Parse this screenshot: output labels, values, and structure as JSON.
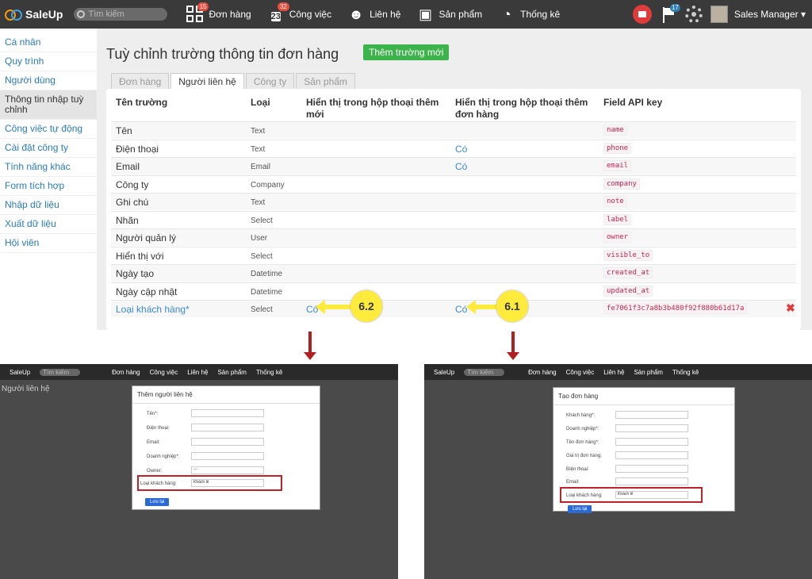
{
  "topbar": {
    "brand": "SaleUp",
    "search_placeholder": "Tìm kiếm",
    "nav": [
      {
        "label": "Đơn hàng",
        "badge": "15"
      },
      {
        "label": "Công việc",
        "badge": "32",
        "calendar_day": "23"
      },
      {
        "label": "Liên hệ"
      },
      {
        "label": "Sản phẩm"
      },
      {
        "label": "Thống kê"
      }
    ],
    "flag_badge": "17",
    "user_name": "Sales Manager"
  },
  "sidebar": {
    "items": [
      {
        "label": "Cá nhân"
      },
      {
        "label": "Quy trình"
      },
      {
        "label": "Người dùng"
      },
      {
        "label": "Thông tin nhập tuỳ chỉnh",
        "active": true
      },
      {
        "label": "Công việc tự động"
      },
      {
        "label": "Cài đặt công ty"
      },
      {
        "label": "Tính năng khác"
      },
      {
        "label": "Form tích hợp"
      },
      {
        "label": "Nhập dữ liệu"
      },
      {
        "label": "Xuất dữ liệu"
      },
      {
        "label": "Hội viên"
      }
    ]
  },
  "page": {
    "title": "Tuỳ chỉnh trường thông tin đơn hàng",
    "add_button": "Thêm trường mới",
    "tabs": [
      "Đơn hàng",
      "Người liên hệ",
      "Công ty",
      "Sản phẩm"
    ],
    "active_tab": 1
  },
  "table": {
    "headers": {
      "name": "Tên trường",
      "type": "Loại",
      "show_add": "Hiển thị trong hộp thoại thêm mới",
      "show_order": "Hiển thị trong hộp thoại thêm đơn hàng",
      "api": "Field API key"
    },
    "rows": [
      {
        "name": "Tên",
        "type": "Text",
        "add": "",
        "order": "",
        "key": "name"
      },
      {
        "name": "Điện thoại",
        "type": "Text",
        "add": "",
        "order": "Có",
        "key": "phone"
      },
      {
        "name": "Email",
        "type": "Email",
        "add": "",
        "order": "Có",
        "key": "email"
      },
      {
        "name": "Công ty",
        "type": "Company",
        "add": "",
        "order": "",
        "key": "company"
      },
      {
        "name": "Ghi chú",
        "type": "Text",
        "add": "",
        "order": "",
        "key": "note"
      },
      {
        "name": "Nhãn",
        "type": "Select",
        "add": "",
        "order": "",
        "key": "label"
      },
      {
        "name": "Người quản lý",
        "type": "User",
        "add": "",
        "order": "",
        "key": "owner"
      },
      {
        "name": "Hiển thị với",
        "type": "Select",
        "add": "",
        "order": "",
        "key": "visible_to"
      },
      {
        "name": "Ngày tạo",
        "type": "Datetime",
        "add": "",
        "order": "",
        "key": "created_at"
      },
      {
        "name": "Ngày cập nhật",
        "type": "Datetime",
        "add": "",
        "order": "",
        "key": "updated_at"
      },
      {
        "name": "Loại khách hàng*",
        "type": "Select",
        "add": "Có",
        "order": "Có",
        "key": "fe7061f3c7a8b3b480f92f880b61d17a",
        "custom": true
      }
    ]
  },
  "callouts": {
    "left": "6.2",
    "right": "6.1"
  },
  "shot_left": {
    "bar_items": [
      "SaleUp",
      "Tìm kiếm",
      "Đơn hàng",
      "Công việc",
      "Liên hệ",
      "Sản phẩm",
      "Thống kê"
    ],
    "page_title": "Người liên hệ",
    "dialog_title": "Thêm người liên hệ",
    "fields": [
      "Tên*:",
      "Điện thoại:",
      "Email:",
      "Doanh nghiệp*:",
      "Owner:",
      "Loại khách hàng:"
    ],
    "owner_value": "---",
    "customer_type_value": "Khách lẻ",
    "save": "Lưu lại"
  },
  "shot_right": {
    "bar_items": [
      "SaleUp",
      "Tìm kiếm",
      "Đơn hàng",
      "Công việc",
      "Liên hệ",
      "Sản phẩm",
      "Thống kê"
    ],
    "dialog_title": "Tạo đơn hàng",
    "fields": [
      "Khách hàng*:",
      "Doanh nghiệp*:",
      "Tên đơn hàng*:",
      "Giá trị đơn hàng:",
      "Điện thoại:",
      "Email:",
      "Loại khách hàng:"
    ],
    "customer_type_value": "Khách lẻ",
    "save": "Lưu lại"
  }
}
